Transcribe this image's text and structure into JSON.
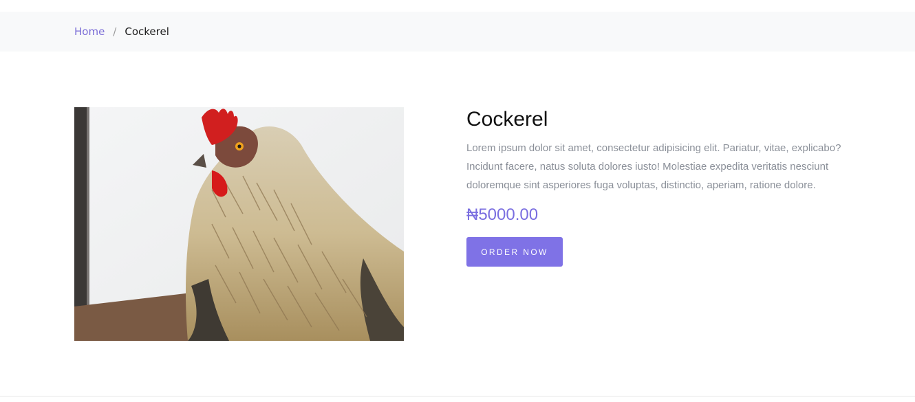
{
  "breadcrumb": {
    "home_label": "Home",
    "separator": "/",
    "current_label": "Cockerel"
  },
  "product": {
    "image_subject": "rooster",
    "title": "Cockerel",
    "description": "Lorem ipsum dolor sit amet, consectetur adipisicing elit. Pariatur, vitae, explicabo? Incidunt facere, natus soluta dolores iusto! Molestiae expedita veritatis nesciunt doloremque sint asperiores fuga voluptas, distinctio, aperiam, ratione dolore.",
    "price": "₦5000.00",
    "order_label": "ORDER NOW"
  },
  "colors": {
    "accent": "#7f72e6",
    "link": "#7a6cd6",
    "breadcrumb_bg": "#f8f9fa",
    "muted_text": "#8a8f98"
  }
}
